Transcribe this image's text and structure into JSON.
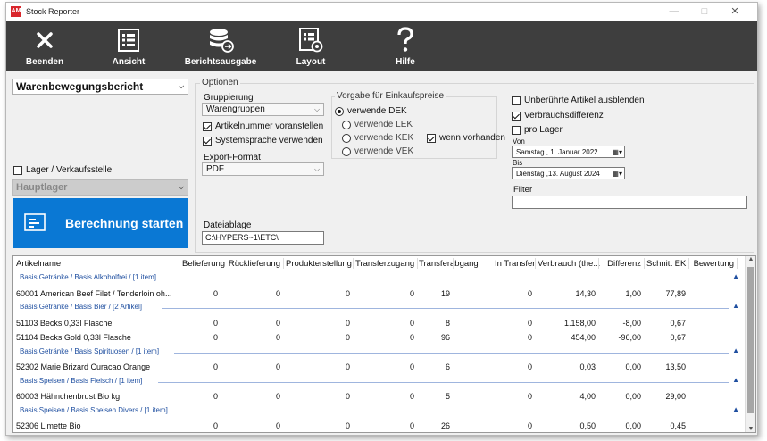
{
  "window": {
    "title": "Stock Reporter",
    "app_icon": "AM",
    "controls": [
      "—",
      "□",
      "✕"
    ]
  },
  "toolbar": {
    "buttons": [
      {
        "label": "Beenden",
        "icon": "close-icon"
      },
      {
        "label": "Ansicht",
        "icon": "list-view-icon"
      },
      {
        "label": "Berichtsausgabe",
        "icon": "database-export-icon"
      },
      {
        "label": "Layout",
        "icon": "layout-icon"
      },
      {
        "label": "Hilfe",
        "icon": "help-icon"
      }
    ]
  },
  "left": {
    "report_select": "Warenbewegungsbericht",
    "lager_checkbox": {
      "label": "Lager / Verkaufsstelle",
      "checked": false
    },
    "lager_select": "Hauptlager",
    "start_button": "Berechnung starten"
  },
  "options": {
    "group_label": "Optionen",
    "gruppierung_label": "Gruppierung",
    "gruppierung_value": "Warengruppen",
    "artikelnummer": {
      "label": "Artikelnummer voranstellen",
      "checked": true
    },
    "systemsprache": {
      "label": "Systemsprache verwenden",
      "checked": true
    },
    "export_label": "Export-Format",
    "export_value": "PDF",
    "ablage_label": "Dateiablage",
    "ablage_value": "C:\\HYPERS~1\\ETC\\",
    "price_group_label": "Vorgabe für Einkaufspreise",
    "price_options": [
      {
        "label": "verwende DEK",
        "selected": true
      },
      {
        "label": "verwende LEK",
        "selected": false
      },
      {
        "label": "verwende KEK",
        "selected": false
      },
      {
        "label": "verwende VEK",
        "selected": false
      }
    ],
    "wenn_vorhanden": {
      "label": "wenn vorhanden",
      "checked": true
    },
    "unberuehrte": {
      "label": "Unberührte Artikel ausblenden",
      "checked": false
    },
    "verbrauchsdifferenz": {
      "label": "Verbrauchsdifferenz",
      "checked": true
    },
    "pro_lager": {
      "label": "pro Lager",
      "checked": false
    },
    "von_label": "Von",
    "von_value": "Samstag ,  1.   Januar   2022",
    "bis_label": "Bis",
    "bis_value": "Dienstag ,13.  August   2024",
    "filter_label": "Filter",
    "filter_value": ""
  },
  "table": {
    "columns": [
      "Artikelname",
      "Belieferung",
      "Rücklieferung",
      "Produkterstellung",
      "Transferzugang",
      "Transferabgang",
      "In Transfer",
      "Verbrauch (the...",
      "Differenz",
      "Schnitt EK",
      "Bewertung"
    ],
    "rows": [
      {
        "type": "group",
        "label": "Basis Getränke /  Basis Alkoholfrei /  [1 item]"
      },
      {
        "type": "item",
        "cells": [
          "60001 American Beef Filet / Tenderloin oh...",
          "0",
          "0",
          "0",
          "0",
          "19",
          "0",
          "14,30",
          "1,00",
          "77,89",
          ""
        ]
      },
      {
        "type": "group",
        "label": "Basis Getränke /  Basis Bier /  [2 Artikel]"
      },
      {
        "type": "item",
        "cells": [
          "51103 Becks 0,33l Flasche",
          "0",
          "0",
          "0",
          "0",
          "8",
          "0",
          "1.158,00",
          "-8,00",
          "0,67",
          ""
        ]
      },
      {
        "type": "item",
        "cells": [
          "51104 Becks Gold 0,33l Flasche",
          "0",
          "0",
          "0",
          "0",
          "96",
          "0",
          "454,00",
          "-96,00",
          "0,67",
          ""
        ]
      },
      {
        "type": "group",
        "label": "Basis Getränke /  Basis Spirituosen /  [1 item]"
      },
      {
        "type": "item",
        "cells": [
          "52302 Marie Brizard Curacao Orange",
          "0",
          "0",
          "0",
          "0",
          "6",
          "0",
          "0,03",
          "0,00",
          "13,50",
          ""
        ]
      },
      {
        "type": "group",
        "label": "Basis Speisen /  Basis Fleisch /  [1 item]"
      },
      {
        "type": "item",
        "cells": [
          "60003 Hähnchenbrust Bio kg",
          "0",
          "0",
          "0",
          "0",
          "5",
          "0",
          "4,00",
          "0,00",
          "29,00",
          ""
        ]
      },
      {
        "type": "group",
        "label": "Basis Speisen /  Basis Speisen Divers /  [1 item]"
      },
      {
        "type": "item",
        "cells": [
          "52306 Limette Bio",
          "0",
          "0",
          "0",
          "0",
          "26",
          "0",
          "0,50",
          "0,00",
          "0,45",
          ""
        ]
      }
    ]
  },
  "colors": {
    "toolbar": "#3e3e3e",
    "accent": "#0a78d4",
    "group_text": "#1f4fa0"
  }
}
